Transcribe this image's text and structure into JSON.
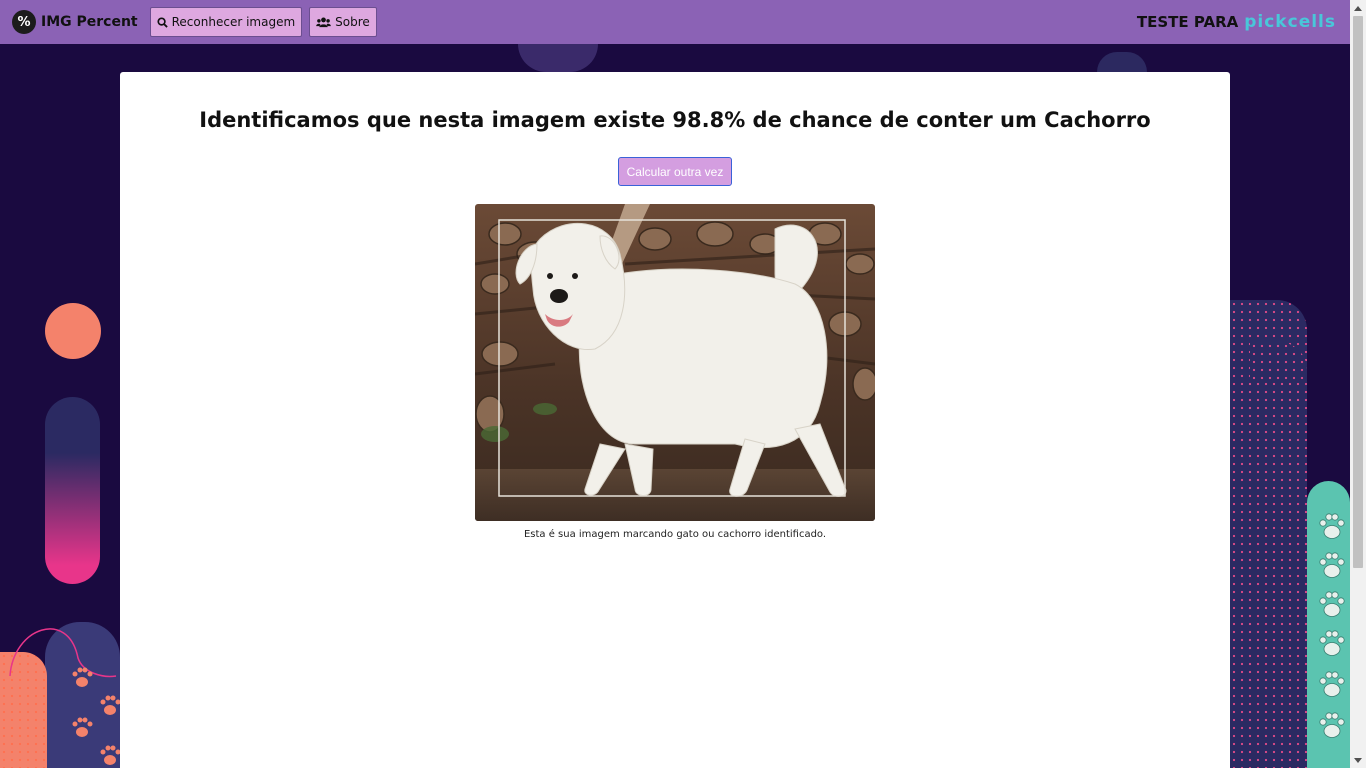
{
  "navbar": {
    "brand_icon": "%",
    "brand_name": "IMG Percent",
    "recognize_label": "Reconhecer imagem",
    "about_label": "Sobre",
    "test_label": "TESTE PARA",
    "partner_logo": "pickcells"
  },
  "result": {
    "title": "Identificamos que nesta imagem existe 98.8% de chance de conter um Cachorro",
    "recalculate_label": "Calcular outra vez",
    "caption": "Esta é sua imagem marcando gato ou cachorro identificado."
  },
  "icons": {
    "brand": "percent-badge-icon",
    "recognize": "search-icon",
    "about": "users-icon",
    "paws": "paw-icon"
  },
  "colors": {
    "navbar": "#8b62b5",
    "background": "#1a0a40",
    "button": "#dea8e0",
    "partner": "#49c7d9"
  }
}
